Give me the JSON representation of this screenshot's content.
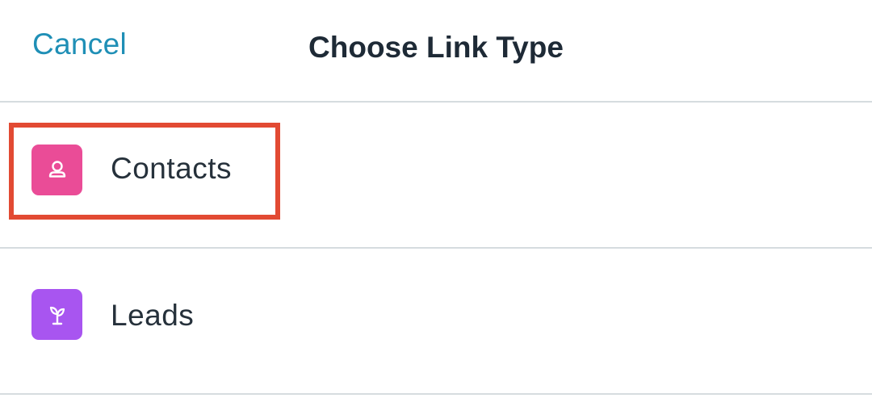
{
  "header": {
    "cancel_label": "Cancel",
    "title": "Choose Link Type"
  },
  "options": [
    {
      "label": "Contacts",
      "icon": "contact-person-icon",
      "color": "#ea4c97"
    },
    {
      "label": "Leads",
      "icon": "sprout-icon",
      "color": "#a855f0"
    }
  ],
  "colors": {
    "accent": "#1f8fb6",
    "divider": "#d6dcdf",
    "highlight_box": "#e24a33"
  }
}
